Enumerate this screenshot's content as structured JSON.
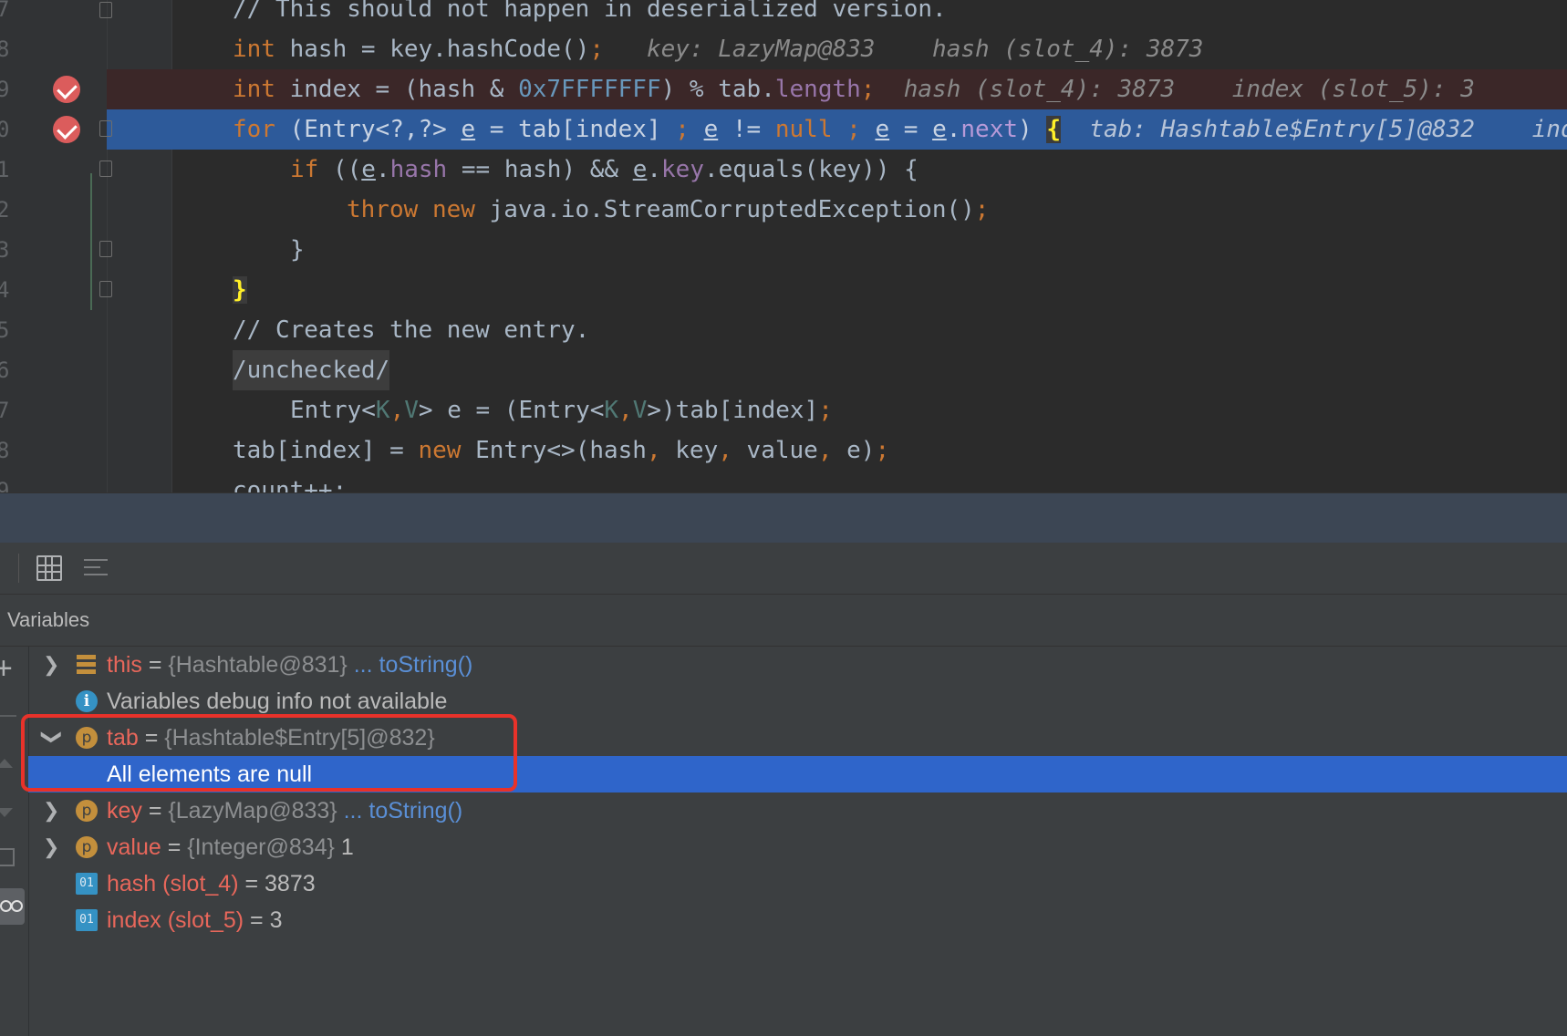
{
  "editor": {
    "lines": [
      {
        "num": "7",
        "text": "// This should not happen in deserialized version."
      },
      {
        "num": "8",
        "kw": "int",
        "code": " hash = key.hashCode()",
        "semi": ";",
        "hint": "key: LazyMap@833    hash (slot_4): 3873"
      },
      {
        "num": "9",
        "kw": "int",
        "code_a": " index = (hash & ",
        "hex": "0x7FFFFFFF",
        "code_b": ") % tab.",
        "field": "length",
        "semi": ";",
        "hint": "hash (slot_4): 3873    index (slot_5): 3"
      },
      {
        "num": "0",
        "kw": "for",
        "p1": " (Entry<?,?> ",
        "e1": "e",
        "p2": " = tab[index] ",
        "semi1": ";",
        "p3": " ",
        "e2": "e",
        "p4": " != ",
        "nul": "null",
        "p5": " ",
        "semi2": ";",
        "p6": " ",
        "e3": "e",
        "p7": " = ",
        "e4": "e",
        "p8": ".",
        "nxt": "next",
        "p9": ") ",
        "brace": "{",
        "hint": "tab: Hashtable$Entry[5]@832    ind"
      },
      {
        "num": "1",
        "kw": "if",
        "p1": " ((",
        "e1": "e",
        "p2": ".",
        "f1": "hash",
        "p3": " == hash) && ",
        "e2": "e",
        "p4": ".",
        "f2": "key",
        "p5": ".equals(key)) {"
      },
      {
        "num": "2",
        "kw1": "throw",
        "kw2": "new",
        "code": " java.io.StreamCorruptedException()",
        "semi": ";"
      },
      {
        "num": "3",
        "text": "}"
      },
      {
        "num": "4",
        "brace": "}"
      },
      {
        "num": "5",
        "text": "// Creates the new entry."
      },
      {
        "num": "6",
        "text": "/unchecked/"
      },
      {
        "num": "7",
        "p1": "Entry<",
        "g1": "K",
        "c1": ",",
        "g2": "V",
        "p2": "> e = (Entry<",
        "g3": "K",
        "c2": ",",
        "g4": "V",
        "p3": ">)tab[index]",
        "semi": ";"
      },
      {
        "num": "8",
        "p1": "tab[index] = ",
        "kw": "new",
        "p2": " Entry<>(hash",
        "c1": ",",
        "p3": " key",
        "c2": ",",
        "p4": " value",
        "c3": ",",
        "p5": " e)",
        "semi": ";"
      },
      {
        "num": "9",
        "text": "count++;"
      }
    ]
  },
  "toolbar": {
    "grid_icon": "table-grid-icon",
    "list_icon": "compare-list-icon"
  },
  "variables": {
    "title": "Variables",
    "rows": [
      {
        "name": "this",
        "eq": " = ",
        "type": "{Hashtable@831}",
        "link": " ... toString()"
      },
      {
        "info": "Variables debug info not available"
      },
      {
        "name": "tab",
        "eq": " = ",
        "type": "{Hashtable$Entry[5]@832}"
      },
      {
        "child": "All elements are null"
      },
      {
        "name": "key",
        "eq": " = ",
        "type": "{LazyMap@833}",
        "link": " ... toString()"
      },
      {
        "name": "value",
        "eq": " = ",
        "type": "{Integer@834}",
        "val": " 1"
      },
      {
        "name": "hash (slot_4)",
        "eq": " = ",
        "val": "3873"
      },
      {
        "name": "index (slot_5)",
        "eq": " = ",
        "val": "3"
      }
    ],
    "icons": {
      "p": "p",
      "info": "i",
      "local": "01"
    }
  },
  "colors": {
    "editor_bg": "#2b2b2b",
    "current_line": "#2d5a9a",
    "breakpoint_line": "#3b2728",
    "selection": "#2f65ca",
    "highlight_box": "#e8322a",
    "keyword": "#cc7832",
    "var_name": "#e8675b"
  }
}
